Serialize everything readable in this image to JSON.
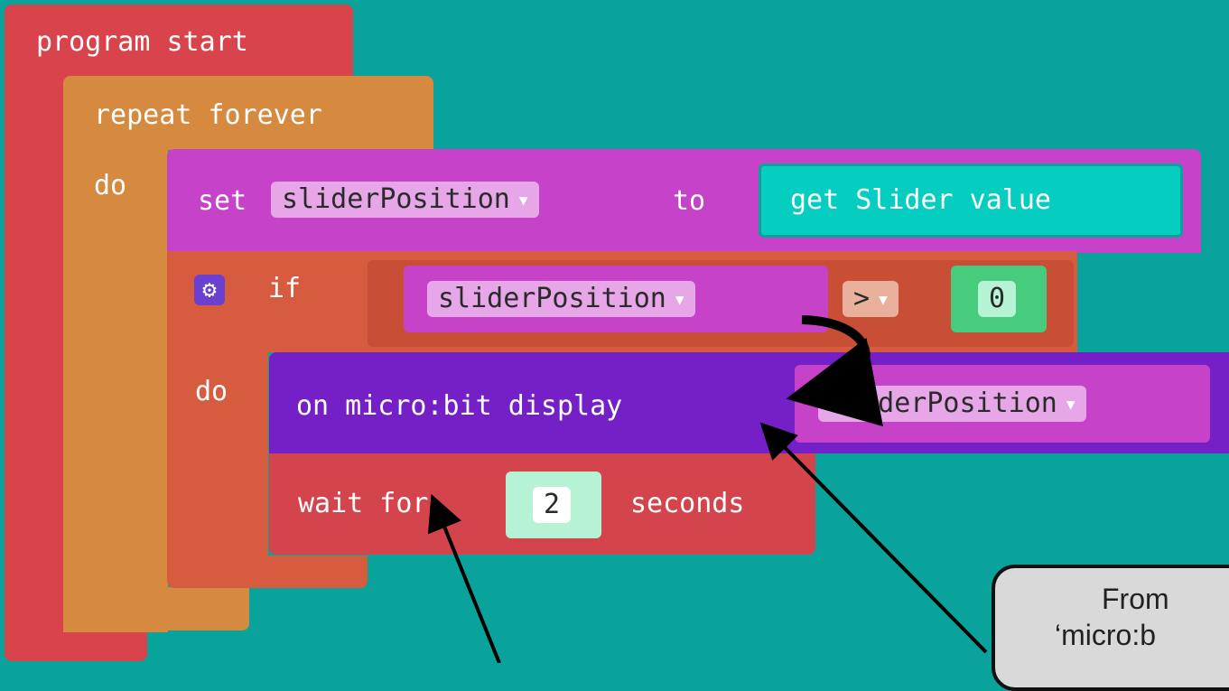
{
  "program": {
    "label": "program start"
  },
  "repeat": {
    "label": "repeat forever",
    "do_label": "do"
  },
  "set_block": {
    "set_label": "set",
    "variable": "sliderPosition",
    "to_label": "to",
    "value_block": "get Slider value"
  },
  "if_block": {
    "if_label": "if",
    "do_label": "do",
    "variable": "sliderPosition",
    "operator": ">",
    "compare_value": "0"
  },
  "display_block": {
    "label": "on micro:bit display",
    "variable": "sliderPosition"
  },
  "wait_block": {
    "wait_label": "wait for",
    "seconds_value": "2",
    "seconds_label": "seconds"
  },
  "callout": {
    "line1": "From",
    "line2": "‘micro:b"
  },
  "icons": {
    "gear": "gear-icon",
    "dropdown": "▾"
  },
  "colors": {
    "background": "#0aa39b",
    "program": "#d9434b",
    "repeat": "#d58a40",
    "set": "#c542c9",
    "getSlider": "#05cdbf",
    "if": "#d75c3f",
    "variable": "#c542c9",
    "operator": "#e9b19c",
    "number": "#47cb7c",
    "display": "#7420c6",
    "wait": "#d4444d"
  }
}
